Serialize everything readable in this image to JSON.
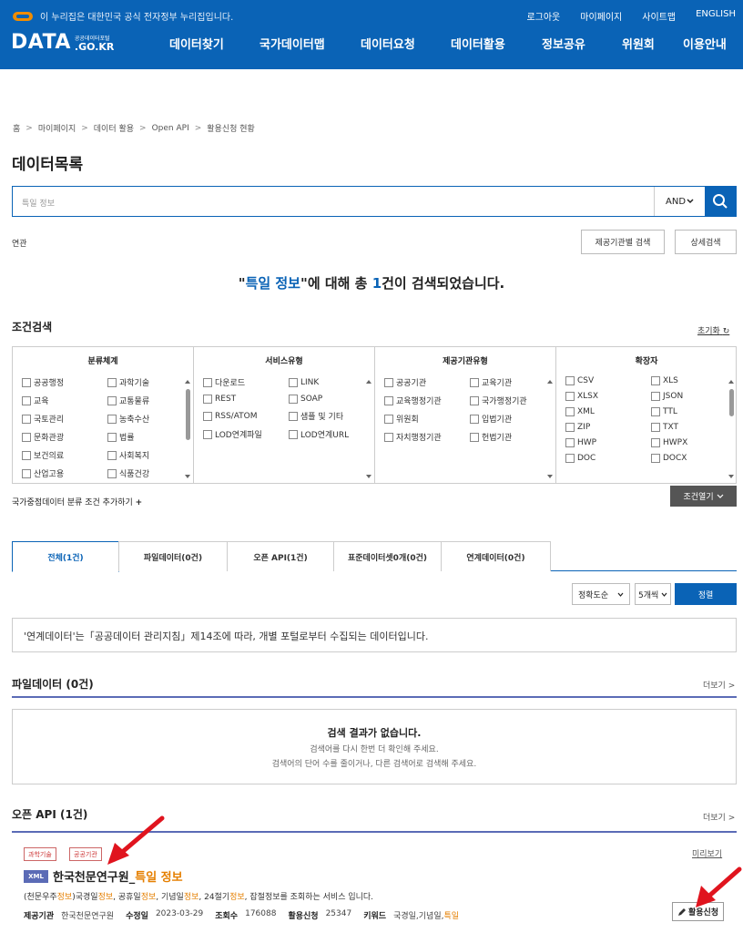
{
  "header": {
    "gov_notice": "이 누리집은 대한민국 공식 전자정부 누리집입니다.",
    "util_links": [
      "로그아웃",
      "마이페이지",
      "사이트맵",
      "ENGLISH"
    ],
    "logo": {
      "main": "DATA",
      "small_top": "공공데이터포털",
      "small_bottom": ".GO.KR"
    },
    "nav": [
      "데이터찾기",
      "국가데이터맵",
      "데이터요청",
      "데이터활용",
      "정보공유",
      "위원회",
      "이용안내"
    ]
  },
  "breadcrumb": [
    "홈",
    "마이페이지",
    "데이터 활용",
    "Open API",
    "활용신청 현황"
  ],
  "page_title": "데이터목록",
  "search": {
    "value": "특일 정보",
    "operator": "AND"
  },
  "related_label": "연관",
  "buttons": {
    "org_search": "제공기관별 검색",
    "detail_search": "상세검색"
  },
  "result": {
    "prefix": "\"",
    "query": "특일 정보",
    "mid": "\"에 대해 총 ",
    "count": "1",
    "suffix": "건이 검색되었습니다."
  },
  "conditions": {
    "title": "조건검색",
    "reset": "초기화",
    "columns": [
      {
        "header": "분류체계",
        "items": [
          "공공행정",
          "과학기술",
          "교육",
          "교통물류",
          "국토관리",
          "농축수산",
          "문화관광",
          "법률",
          "보건의료",
          "사회복지",
          "산업고용",
          "식품건강"
        ]
      },
      {
        "header": "서비스유형",
        "items": [
          "다운로드",
          "LINK",
          "REST",
          "SOAP",
          "RSS/ATOM",
          "샘플 및 기타",
          "LOD연계파일",
          "LOD연계URL"
        ]
      },
      {
        "header": "제공기관유형",
        "items": [
          "공공기관",
          "교육기관",
          "교육행정기관",
          "국가행정기관",
          "위원회",
          "입법기관",
          "자치행정기관",
          "헌법기관"
        ]
      },
      {
        "header": "확장자",
        "items": [
          "CSV",
          "XLS",
          "XLSX",
          "JSON",
          "XML",
          "TTL",
          "ZIP",
          "TXT",
          "HWP",
          "HWPX",
          "DOC",
          "DOCX"
        ]
      }
    ],
    "add_label": "국가중점데이터 분류 조건 추가하기",
    "add_sign": "+",
    "open_label": "조건열기"
  },
  "tabs": [
    "전체(1건)",
    "파일데이터(0건)",
    "오픈 API(1건)",
    "표준데이터셋0개(0건)",
    "연계데이터(0건)"
  ],
  "sort": {
    "order": "정확도순",
    "per_page": "5개씩",
    "button": "정렬"
  },
  "notice": "'연계데이터'는「공공데이터 관리지침」제14조에 따라, 개별 포털로부터 수집되는 데이터입니다.",
  "file_section": {
    "title": "파일데이터 (0건)",
    "more": "더보기 >",
    "empty_title": "검색 결과가 없습니다.",
    "empty_line1": "검색어를 다시 한번 더 확인해 주세요.",
    "empty_line2": "검색어의 단어 수를 줄이거나, 다른 검색어로 검색해 주세요."
  },
  "api_section": {
    "title": "오픈 API (1건)",
    "more": "더보기 >",
    "item": {
      "badges": [
        "과학기술",
        "공공기관"
      ],
      "preview": "미리보기",
      "type": "XML",
      "org": "한국천문연구원_",
      "keyword": "특일 정보",
      "desc": {
        "p1": "(천문우주",
        "h1": "정보",
        "p2": ")국경일",
        "h2": "정보",
        "p3": ", 공휴일",
        "h3": "정보",
        "p4": ", 기념일",
        "h4": "정보",
        "p5": ", 24절기",
        "h5": "정보",
        "p6": ", 잡절정보를 조회하는 서비스 입니다."
      },
      "meta": {
        "provider_label": "제공기관",
        "provider": "한국천문연구원",
        "modified_label": "수정일",
        "modified": "2023-03-29",
        "views_label": "조회수",
        "views": "176088",
        "apply_label": "활용신청",
        "apply": "25347",
        "keyword_label": "키워드",
        "keywords": "국경일,기념일,",
        "keyword_hl": "특일"
      },
      "apply_button": "활용신청"
    }
  },
  "colors": {
    "primary": "#0a63b6",
    "accent": "#e57f00",
    "arrow": "#e0141e"
  }
}
